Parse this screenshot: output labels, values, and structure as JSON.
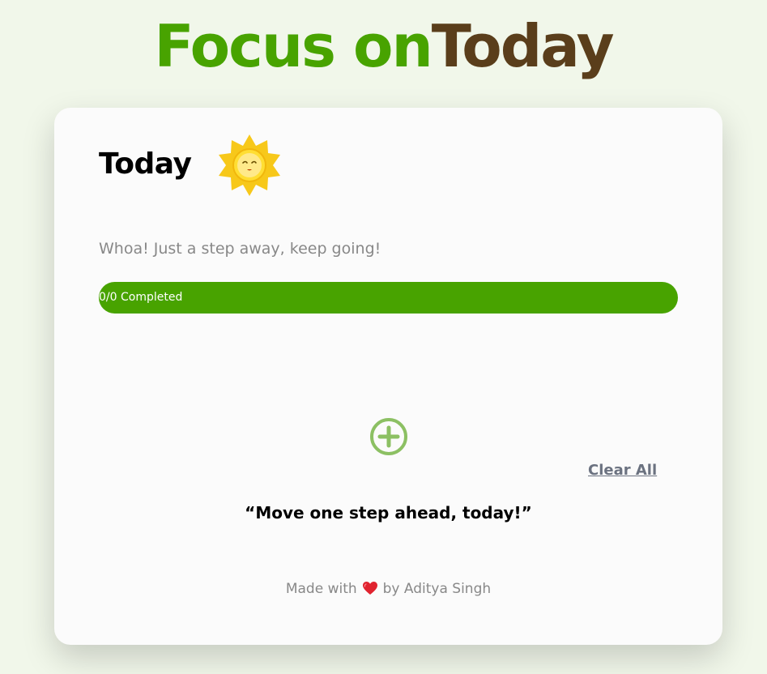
{
  "header": {
    "title_part1": "Focus on",
    "title_part2": "Today"
  },
  "card": {
    "heading": "Today",
    "heading_icon": "sun-icon",
    "encouragement": "Whoa! Just a step away, keep going!",
    "progress": {
      "label": "0/0 Completed",
      "completed": 0,
      "total": 0
    },
    "add_icon": "plus-circle-icon",
    "clear_all_label": "Clear All",
    "quote": "“Move one step ahead, today!”",
    "footer": {
      "made_with": "Made with",
      "heart_icon": "heart-icon",
      "by_author": "by Aditya Singh"
    }
  },
  "colors": {
    "background": "#f1f7ea",
    "brand_green": "#48a300",
    "brand_brown": "#5a3e1b",
    "add_icon_green": "#8cc063",
    "muted_text": "#888888",
    "clear_all": "#6b7280",
    "heart": "#e0232f"
  }
}
